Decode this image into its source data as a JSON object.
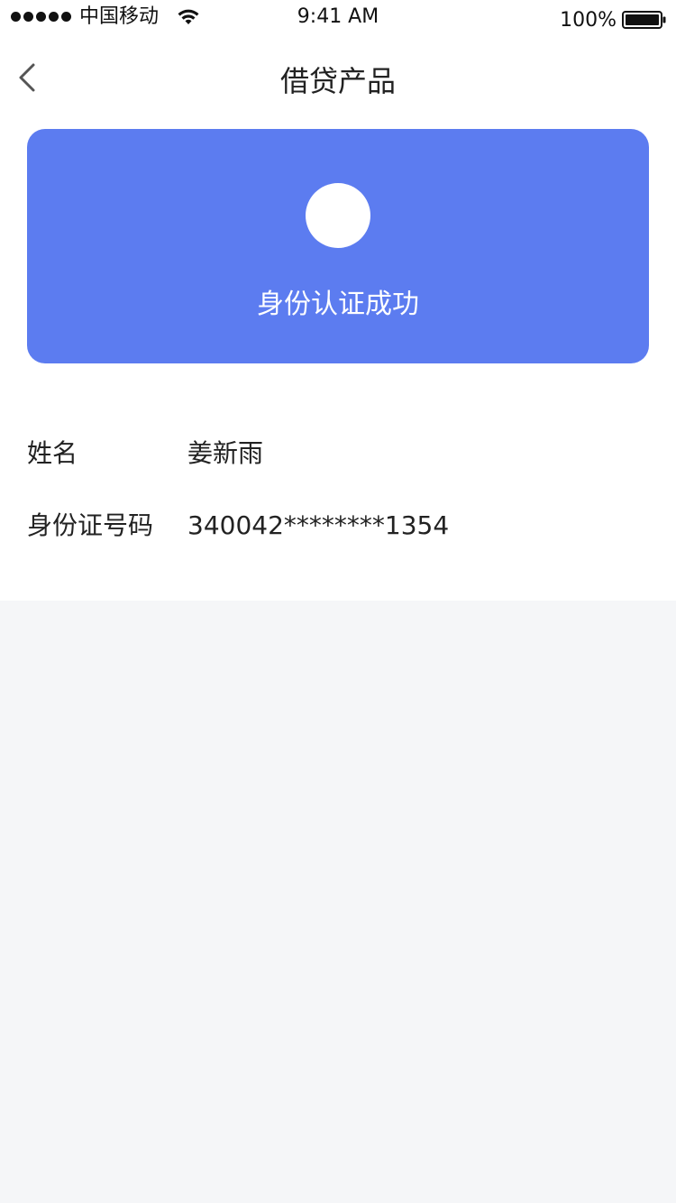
{
  "status_bar": {
    "carrier": "中国移动",
    "time": "9:41 AM",
    "battery": "100%"
  },
  "nav": {
    "title": "借贷产品",
    "back_icon": "chevron-left-icon"
  },
  "card": {
    "message": "身份认证成功",
    "color": "#5c7cf0"
  },
  "info": {
    "name_label": "姓名",
    "name_value": "姜新雨",
    "id_label": "身份证号码",
    "id_value": "340042********1354"
  },
  "colors": {
    "bottom_background": "#f5f6f8"
  }
}
